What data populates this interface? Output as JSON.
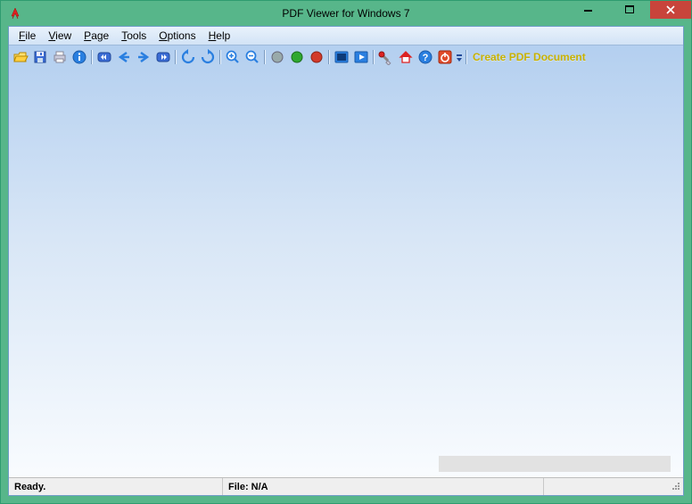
{
  "window": {
    "title": "PDF Viewer for Windows 7"
  },
  "menubar": {
    "items": [
      {
        "label": "File",
        "accel": 0
      },
      {
        "label": "View",
        "accel": 0
      },
      {
        "label": "Page",
        "accel": 0
      },
      {
        "label": "Tools",
        "accel": 0
      },
      {
        "label": "Options",
        "accel": 0
      },
      {
        "label": "Help",
        "accel": 0
      }
    ]
  },
  "toolbar": {
    "create_link": "Create PDF Document"
  },
  "status": {
    "ready": "Ready.",
    "file": "File: N/A"
  }
}
